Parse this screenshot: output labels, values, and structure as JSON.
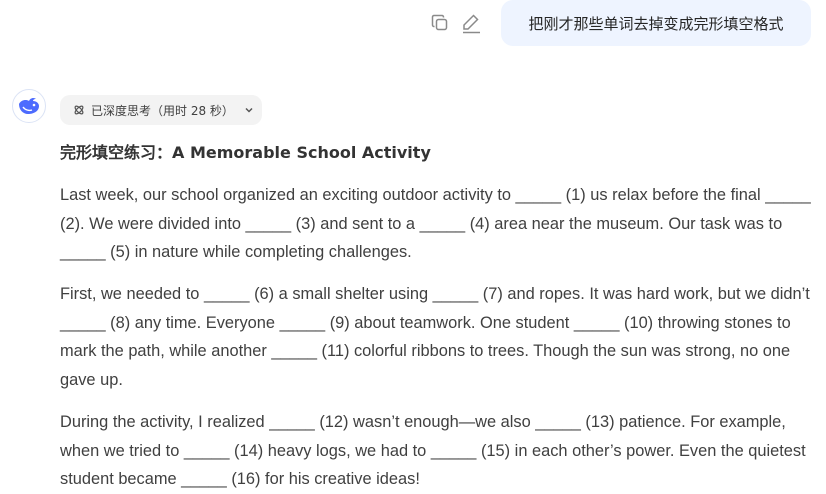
{
  "user_message": {
    "text": "把刚才那些单词去掉变成完形填空格式"
  },
  "actions": {
    "copy_icon": "copy-icon",
    "edit_icon": "edit-icon"
  },
  "thinking": {
    "label": "已深度思考（用时 28 秒）"
  },
  "response": {
    "heading": "完形填空练习：A Memorable School Activity",
    "paragraphs": [
      "Last week, our school organized an exciting outdoor activity to _____ (1) us relax before the final _____ (2). We were divided into _____ (3) and sent to a _____ (4) area near the museum. Our task was to _____ (5) in nature while completing challenges.",
      "First, we needed to _____ (6) a small shelter using _____ (7) and ropes. It was hard work, but we didn’t _____ (8) any time. Everyone _____ (9) about teamwork. One student _____ (10) throwing stones to mark the path, while another _____ (11) colorful ribbons to trees. Though the sun was strong, no one gave up.",
      "During the activity, I realized _____ (12) wasn’t enough—we also _____ (13) patience. For example, when we tried to _____ (14) heavy logs, we had to _____ (15) in each other’s power. Even the quietest student became _____ (16) for his creative ideas!"
    ]
  },
  "colors": {
    "user_bubble_bg": "#eef4ff",
    "pill_bg": "#f3f3f3",
    "brand_blue": "#4d6bfe",
    "text": "#404040"
  }
}
